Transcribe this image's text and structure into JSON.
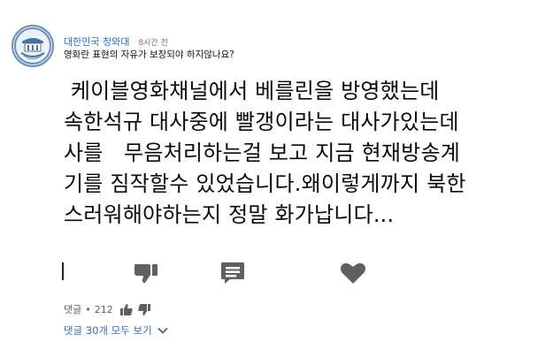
{
  "post": {
    "channel": "대한민국 청와대",
    "time": "8시간 전",
    "title": "영화란 표현의 자유가 보장되야 하지않나요?",
    "body_lines": [
      " 케이블영화채널에서 베를린을 방영했는데",
      "속한석규 대사중에 빨갱이라는 대사가있는데",
      "사를   무음처리하는걸 보고 지금 현재방송계",
      "기를 짐작할수 있었습니다.왜이렇게까지 북한",
      "스러워해야하는지 정말 화가납니다..."
    ]
  },
  "actions": {
    "dislike_icon": "thumbs-down-icon",
    "comment_icon": "comment-icon",
    "like_icon": "heart-icon"
  },
  "meta": {
    "comments_label": "댓글",
    "separator": "•",
    "count": "212"
  },
  "replies": {
    "label": "댓글 30개 모두 보기"
  },
  "colors": {
    "channel": "#2f6fbd",
    "icon": "#606060",
    "link": "#3b6fb0"
  }
}
